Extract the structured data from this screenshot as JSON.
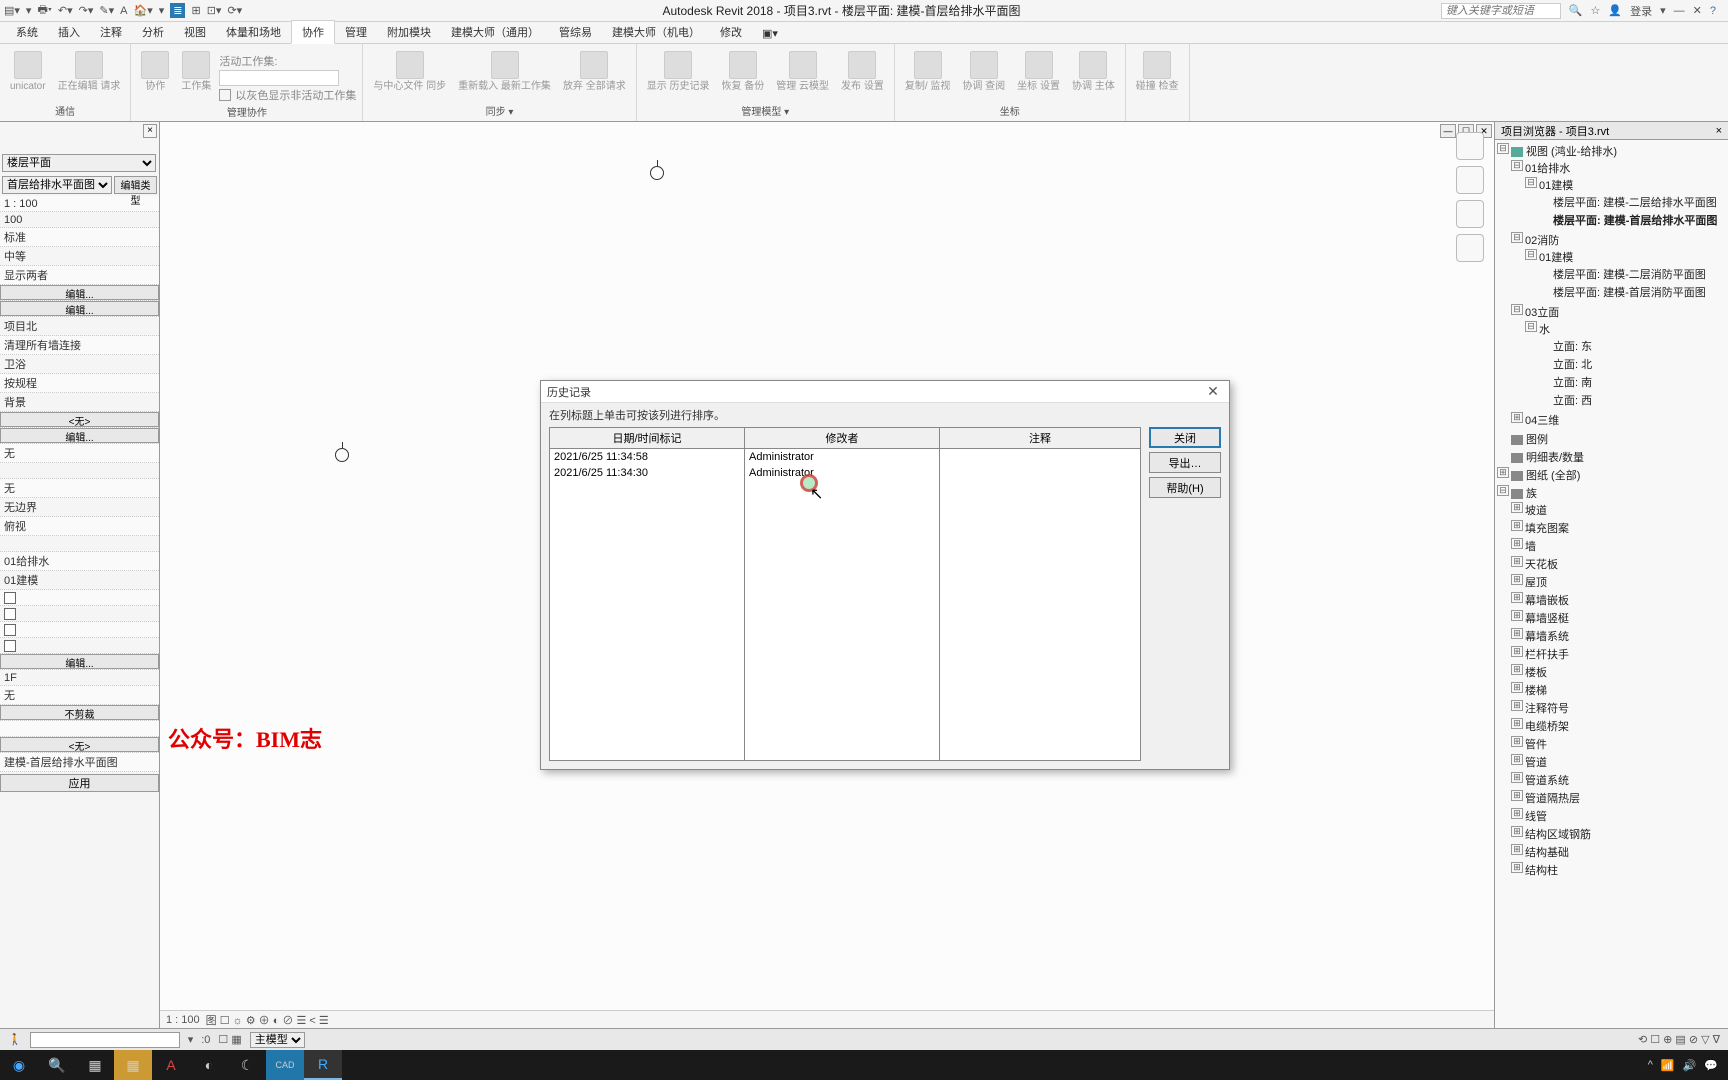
{
  "app": {
    "title": "Autodesk Revit 2018 -    项目3.rvt - 楼层平面: 建模-首层给排水平面图",
    "search_placeholder": "键入关键字或短语",
    "login": "登录"
  },
  "tabs": [
    "系统",
    "插入",
    "注释",
    "分析",
    "视图",
    "体量和场地",
    "协作",
    "管理",
    "附加模块",
    "建模大师（通用）",
    "管综易",
    "建模大师（机电）",
    "修改"
  ],
  "active_tab": "协作",
  "ribbon": {
    "groups": [
      {
        "label": "通信",
        "items": [
          {
            "txt": "unicator"
          },
          {
            "txt": "正在编辑\n请求"
          }
        ]
      },
      {
        "label": "",
        "items": [
          {
            "txt": "协作"
          },
          {
            "txt": "工作集"
          }
        ],
        "sub": {
          "label1": "活动工作集:",
          "chk_label": "以灰色显示非活动工作集"
        }
      },
      {
        "label": "同步 ▾",
        "items": [
          {
            "txt": "与中心文件\n同步"
          },
          {
            "txt": "重新载入\n最新工作集"
          },
          {
            "txt": "放弃\n全部请求"
          }
        ]
      },
      {
        "label": "管理模型 ▾",
        "items": [
          {
            "txt": "显示\n历史记录"
          },
          {
            "txt": "恢复\n备份"
          },
          {
            "txt": "管理\n云模型"
          },
          {
            "txt": "发布\n设置"
          }
        ]
      },
      {
        "label": "",
        "items": [
          {
            "txt": "复制/\n监视"
          },
          {
            "txt": "协调\n查阅"
          },
          {
            "txt": "坐标\n设置"
          },
          {
            "txt": "协调\n主体"
          }
        ]
      },
      {
        "label": "坐标",
        "items": [
          {
            "txt": "碰撞\n检查"
          }
        ]
      }
    ],
    "group0_label": "通信",
    "group1_label": "管理协作",
    "group2_label": "同步 ▾",
    "group3_label": "管理模型 ▾",
    "group5_label": "坐标"
  },
  "props": {
    "type_selector": "楼层平面",
    "type_instance": "首层给排水平面图",
    "edit_type": "编辑类型",
    "rows": [
      {
        "v": "1 : 100"
      },
      {
        "v": "100"
      },
      {
        "v": "标准"
      },
      {
        "v": "中等"
      },
      {
        "v": "显示两者"
      },
      {
        "btn": "编辑..."
      },
      {
        "btn": "编辑..."
      },
      {
        "v": "项目北"
      },
      {
        "v": "清理所有墙连接"
      },
      {
        "v": "卫浴"
      },
      {
        "v": "按规程"
      },
      {
        "v": "背景"
      },
      {
        "btn": "<无>"
      },
      {
        "btn": "编辑..."
      },
      {
        "v": "无"
      },
      {
        "v": ""
      },
      {
        "v": "无"
      },
      {
        "v": "无边界"
      },
      {
        "v": "俯视"
      },
      {
        "v": ""
      },
      {
        "v": "01给排水"
      },
      {
        "v": "01建模"
      },
      {
        "chk": true
      },
      {
        "chk": true
      },
      {
        "chk": true
      },
      {
        "chk": true
      },
      {
        "btn": "编辑..."
      },
      {
        "v": "1F"
      },
      {
        "v": "无"
      },
      {
        "btn": "不剪裁"
      },
      {
        "v": ""
      },
      {
        "btn": "<无>"
      },
      {
        "v": "建模-首层给排水平面图"
      }
    ],
    "apply": "应用"
  },
  "canvas": {
    "watermark": "公众号：BIM志",
    "scale": "1 : 100",
    "statusbar_icons": "图 ☐ ☼ ⚙ ⊕ ◐ ⊘ ☰ < ☰"
  },
  "dialog": {
    "title": "历史记录",
    "hint": "在列标题上单击可按该列进行排序。",
    "headers": [
      "日期/时间标记",
      "修改者",
      "注释"
    ],
    "rows": [
      {
        "dt": "2021/6/25 11:34:58",
        "who": "Administrator",
        "note": ""
      },
      {
        "dt": "2021/6/25 11:34:30",
        "who": "Administrator",
        "note": ""
      }
    ],
    "close": "关闭",
    "export": "导出…",
    "help": "帮助(H)"
  },
  "browser": {
    "title": "项目浏览器 - 项目3.rvt",
    "root": "视图 (鸿业-给排水)",
    "nodes": {
      "n01": "01给排水",
      "n01_01": "01建模",
      "n01_01_a": "楼层平面: 建模-二层给排水平面图",
      "n01_01_b": "楼层平面: 建模-首层给排水平面图",
      "n02": "02消防",
      "n02_01": "01建模",
      "n02_01_a": "楼层平面: 建模-二层消防平面图",
      "n02_01_b": "楼层平面: 建模-首层消防平面图",
      "n03": "03立面",
      "n03_w": "水",
      "e_e": "立面: 东",
      "e_n": "立面: 北",
      "e_s": "立面: 南",
      "e_w": "立面: 西",
      "n04": "04三维",
      "legend": "图例",
      "sched": "明细表/数量",
      "sheets": "图纸 (全部)",
      "fam": "族",
      "f1": "坡道",
      "f2": "填充图案",
      "f3": "墙",
      "f4": "天花板",
      "f5": "屋顶",
      "f6": "幕墙嵌板",
      "f7": "幕墙竖梃",
      "f8": "幕墙系统",
      "f9": "栏杆扶手",
      "f10": "楼板",
      "f11": "楼梯",
      "f12": "注释符号",
      "f13": "电缆桥架",
      "f14": "管件",
      "f15": "管道",
      "f16": "管道系统",
      "f17": "管道隔热层",
      "f18": "线管",
      "f19": "结构区域钢筋",
      "f20": "结构基础",
      "f21": "结构柱"
    }
  },
  "status": {
    "press": "",
    "zero": ":0",
    "model": "主模型"
  }
}
